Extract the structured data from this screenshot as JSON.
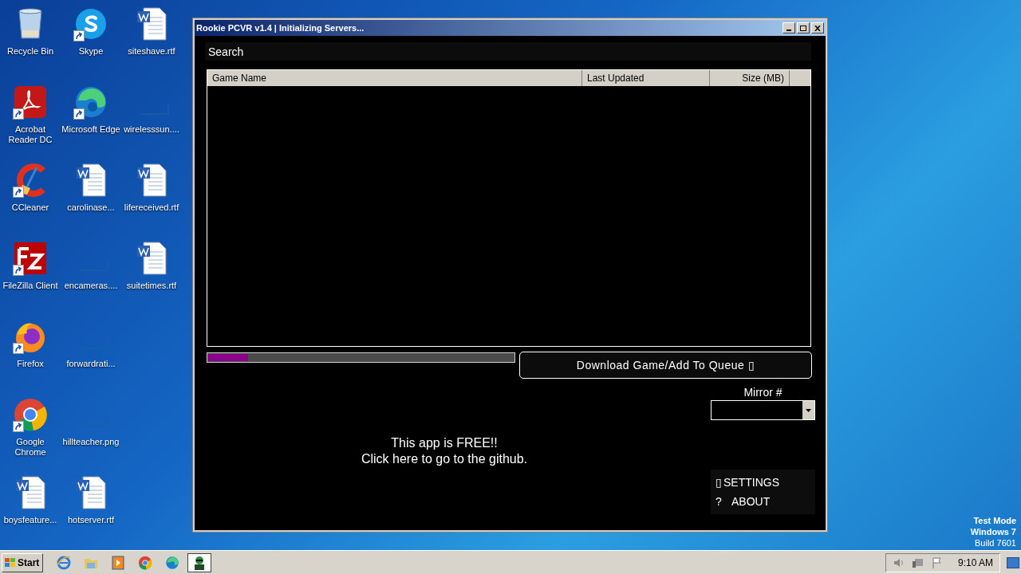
{
  "desktop": {
    "columns": [
      [
        {
          "label": "Recycle Bin",
          "kind": "recycle",
          "shortcut": false
        },
        {
          "label": "Acrobat Reader DC",
          "kind": "acrobat",
          "shortcut": true
        },
        {
          "label": "CCleaner",
          "kind": "ccleaner",
          "shortcut": true
        },
        {
          "label": "FileZilla Client",
          "kind": "filezilla",
          "shortcut": true
        },
        {
          "label": "Firefox",
          "kind": "firefox",
          "shortcut": true
        },
        {
          "label": "Google Chrome",
          "kind": "chrome",
          "shortcut": true
        },
        {
          "label": "boysfeature...",
          "kind": "word",
          "shortcut": false
        }
      ],
      [
        {
          "label": "Skype",
          "kind": "skype",
          "shortcut": true
        },
        {
          "label": "Microsoft Edge",
          "kind": "edge",
          "shortcut": true
        },
        {
          "label": "carolinase...",
          "kind": "word",
          "shortcut": false
        },
        {
          "label": "encameras....",
          "kind": "blank",
          "shortcut": false
        },
        {
          "label": "forwardrati...",
          "kind": "blank",
          "shortcut": false
        },
        {
          "label": "hillteacher.png",
          "kind": "blank",
          "shortcut": false
        },
        {
          "label": "hotserver.rtf",
          "kind": "word",
          "shortcut": false
        }
      ],
      [
        {
          "label": "siteshave.rtf",
          "kind": "word",
          "shortcut": false
        },
        {
          "label": "wirelesssun....",
          "kind": "blank",
          "shortcut": false
        },
        {
          "label": "lifereceived.rtf",
          "kind": "word",
          "shortcut": false
        },
        {
          "label": "suitetimes.rtf",
          "kind": "word",
          "shortcut": false
        }
      ]
    ],
    "watermark": [
      "Test Mode",
      "Windows 7",
      "Build 7601"
    ]
  },
  "window": {
    "title": "Rookie PCVR v1.4 | Initializing Servers...",
    "search": {
      "placeholder": "Search"
    },
    "table": {
      "columns": [
        "Game Name",
        "Last Updated",
        "Size (MB)"
      ]
    },
    "progress": {
      "level": 0.13
    },
    "download_button": "Download Game/Add To Queue ▯",
    "mirror": {
      "label": "Mirror #"
    },
    "message": [
      "This app is FREE!!",
      "Click here to go to the github."
    ],
    "menu": [
      {
        "icon": "▯",
        "label": "SETTINGS"
      },
      {
        "icon": "?",
        "label": "ABOUT"
      }
    ]
  },
  "taskbar": {
    "start": "Start",
    "quick_launch": [
      {
        "kind": "ie"
      },
      {
        "kind": "folder"
      },
      {
        "kind": "media"
      },
      {
        "kind": "chrome"
      },
      {
        "kind": "edge"
      }
    ],
    "tasks": [
      {
        "kind": "robot",
        "selected": true
      }
    ],
    "clock": "9:10 AM"
  }
}
